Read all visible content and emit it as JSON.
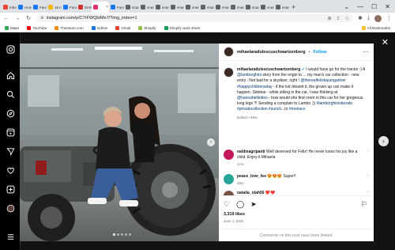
{
  "browser": {
    "tabs": [
      {
        "label": "Inbo",
        "color": "#ea4335"
      },
      {
        "label": "Hom",
        "color": "#1877f2"
      },
      {
        "label": "Face",
        "color": "#1877f2"
      },
      {
        "label": "15 n",
        "color": "#f4b400"
      },
      {
        "label": "Face",
        "color": "#1877f2"
      },
      {
        "label": "Dem",
        "color": "#d32f2f"
      },
      {
        "label": "",
        "color": "#e1306c",
        "active": true
      },
      {
        "label": "Face",
        "color": "#1877f2"
      },
      {
        "label": "imac",
        "color": "#5f6368"
      },
      {
        "label": "imac",
        "color": "#5f6368"
      },
      {
        "label": "imac",
        "color": "#5f6368"
      },
      {
        "label": "imac",
        "color": "#5f6368"
      },
      {
        "label": "imac",
        "color": "#5f6368"
      },
      {
        "label": "imac",
        "color": "#5f6368"
      },
      {
        "label": "imac",
        "color": "#5f6368"
      },
      {
        "label": "imac",
        "color": "#5f6368"
      },
      {
        "label": "imac",
        "color": "#5f6368"
      },
      {
        "label": "imac",
        "color": "#5f6368"
      },
      {
        "label": "imac",
        "color": "#5f6368"
      }
    ],
    "new_tab": "+",
    "window_controls": {
      "chevron": "⌄",
      "min": "—",
      "max": "☐",
      "close": "✕"
    },
    "nav": {
      "back": "←",
      "forward": "→",
      "reload": "↻"
    },
    "url": "instagram.com/p/C7rFWQbIMn7/?img_index=1",
    "bookmarks": [
      {
        "label": "Maps",
        "color": "#34a853"
      },
      {
        "label": "YouTube",
        "color": "#ff0000"
      },
      {
        "label": "Thesauro.com",
        "color": "#fb8c00"
      },
      {
        "label": "Gdrive",
        "color": "#1a73e8"
      },
      {
        "label": "Gmail",
        "color": "#ea4335"
      },
      {
        "label": "Shopify",
        "color": "#95bf47"
      },
      {
        "label": "Shopify work sheet",
        "color": "#0f9d58"
      }
    ],
    "all_bookmarks": "All Bookmarks"
  },
  "post": {
    "username": "mihaelaradulescuschwartzenberg",
    "follow_label": "Follow",
    "caption_user": "mihaelaradulescuschwartzenberg",
    "caption_parts": {
      "a": " I would have go for the tractor :) A ",
      "b": "@lamborghini",
      "c": " story from the origin to ... my man's car collection - new entry : Not bad for a skydiver, right ! ",
      "d": "@therealfelixbaumgartner #happychildrensday",
      "e": " - if the kid dreamt it, the grown up can make it happen. Sidebar - while sitting in the car, I was thinking at ",
      "f": "@hannahelliottxo",
      "g": " - how would she find room in this car for her gorgeous long legs ?! Sending a complain to Lambo ;)) ",
      "h": "#lamborghinisterrato #privatecollection #zurich",
      "i": "...to ",
      "j": "#monaco"
    },
    "caption_meta": "Edited • 50w",
    "comments": [
      {
        "user": "naldisagripanti",
        "text": " Well deserved for Felix! He never loses his joy like a child. Enjoy it Mihaela",
        "meta": "17w",
        "color": "#c2185b"
      },
      {
        "user": "peace_love_fee",
        "text": " 😍😍😍 Super!!",
        "meta": "48w",
        "color": "#26a69a"
      },
      {
        "user": "natalia_olah56",
        "text": " ❤️❤️",
        "meta": "",
        "color": "#795548"
      }
    ],
    "likes": "3,319 likes",
    "date": "June 1, 2024",
    "comments_limited": "Comments on this post have been limited."
  }
}
